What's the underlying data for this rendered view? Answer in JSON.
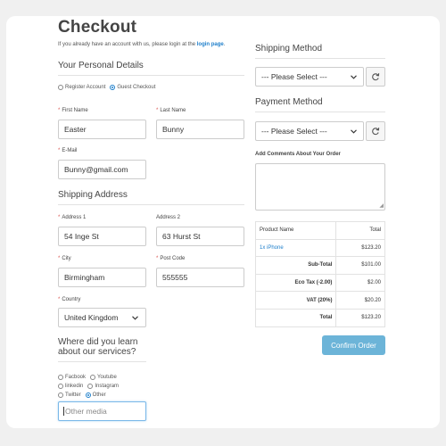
{
  "page": {
    "title": "Checkout",
    "login_note": "If you already have an account with us, please login at the ",
    "login_link": "login page",
    "login_suffix": "."
  },
  "personal": {
    "heading": "Your Personal Details",
    "register_label": "Register Account",
    "guest_label": "Guest Checkout",
    "selected": "guest",
    "first_name_label": "First Name",
    "first_name_value": "Easter",
    "last_name_label": "Last Name",
    "last_name_value": "Bunny",
    "email_label": "E-Mail",
    "email_value": "Bunny@gmail.com"
  },
  "shipping_address": {
    "heading": "Shipping Address",
    "address1_label": "Address 1",
    "address1_value": "54 Inge St",
    "address2_label": "Address 2",
    "address2_value": "63 Hurst St",
    "city_label": "City",
    "city_value": "Birmingham",
    "postcode_label": "Post Code",
    "postcode_value": "555555",
    "country_label": "Country",
    "country_value": "United Kingdom"
  },
  "survey": {
    "heading_line1": "Where did you learn",
    "heading_line2": "about our services?",
    "options": [
      "Facbook",
      "Youtube",
      "linkedin",
      "Instagram",
      "Twitter",
      "Other"
    ],
    "selected": "Other",
    "other_placeholder": "Other media"
  },
  "shipping_method": {
    "heading": "Shipping Method",
    "select_value": "--- Please Select ---"
  },
  "payment_method": {
    "heading": "Payment Method",
    "select_value": "--- Please Select ---"
  },
  "comments": {
    "label": "Add Comments About Your Order"
  },
  "order": {
    "col_product": "Product Name",
    "col_total": "Total",
    "item_name": "1x iPhone",
    "item_total": "$123.20",
    "subtotal_label": "Sub-Total",
    "subtotal_value": "$101.00",
    "ecotax_label": "Eco Tax (-2.00)",
    "ecotax_value": "$2.00",
    "vat_label": "VAT (20%)",
    "vat_value": "$20.20",
    "total_label": "Total",
    "total_value": "$123.20"
  },
  "confirm_label": "Confirm Order",
  "icons": {
    "refresh": "refresh-icon",
    "chevron": "chevron-down-icon"
  },
  "colors": {
    "link": "#1e7fcb",
    "required": "#d9534f",
    "confirm_button": "#6cb4d8"
  }
}
